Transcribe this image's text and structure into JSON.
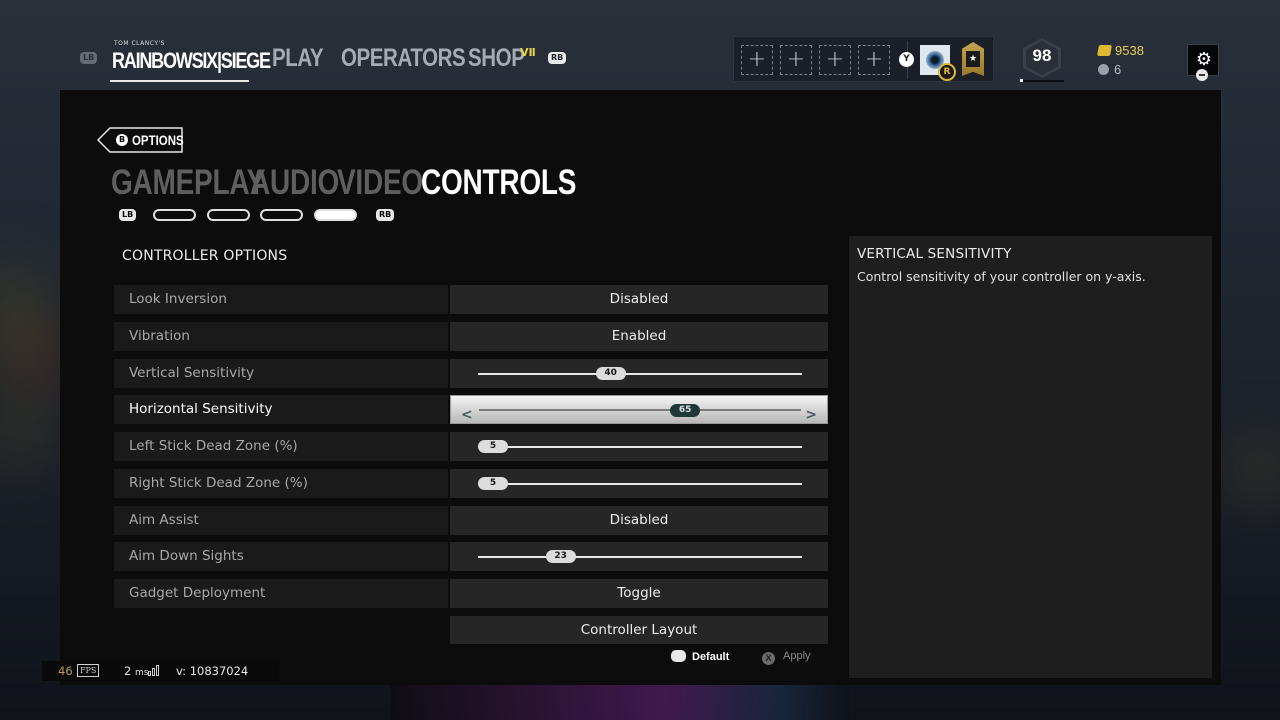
{
  "topnav": {
    "lb": "LB",
    "rb": "RB",
    "logo_small": "TOM CLANCY'S",
    "logo_main": "RAINBOWSIX|SIEGE",
    "items": [
      {
        "label": "PLAY"
      },
      {
        "label": "OPERATORS"
      },
      {
        "label": "SHOP"
      }
    ],
    "shop_badge": "VⅡ",
    "squad": {
      "slots": [
        "+",
        "+",
        "+",
        "+"
      ],
      "invite_button": "Y",
      "rank_badge": "R"
    },
    "level": "98",
    "level_progress": 0.05,
    "credits": "9538",
    "renown": "6",
    "settings_icon": "gear-icon"
  },
  "options": {
    "back_button_key": "B",
    "back_label": "OPTIONS",
    "tabs": [
      {
        "label": "GAMEPLAY",
        "active": false
      },
      {
        "label": "AUDIO",
        "active": false
      },
      {
        "label": "VIDEO",
        "active": false
      },
      {
        "label": "CONTROLS",
        "active": true
      }
    ],
    "tab_lb": "LB",
    "tab_rb": "RB",
    "pagination": {
      "total": 4,
      "active_index": 3
    },
    "section_title": "CONTROLLER OPTIONS",
    "rows": [
      {
        "label": "Look Inversion",
        "type": "toggle",
        "value": "Disabled"
      },
      {
        "label": "Vibration",
        "type": "toggle",
        "value": "Enabled"
      },
      {
        "label": "Vertical Sensitivity",
        "type": "slider",
        "value": "40",
        "fraction": 0.4
      },
      {
        "label": "Horizontal Sensitivity",
        "type": "slider",
        "value": "65",
        "fraction": 0.65,
        "selected": true
      },
      {
        "label": "Left Stick Dead Zone (%)",
        "type": "slider",
        "value": "5",
        "fraction": 0.0
      },
      {
        "label": "Right Stick Dead Zone (%)",
        "type": "slider",
        "value": "5",
        "fraction": 0.0
      },
      {
        "label": "Aim Assist",
        "type": "toggle",
        "value": "Disabled"
      },
      {
        "label": "Aim Down Sights",
        "type": "slider",
        "value": "23",
        "fraction": 0.23
      },
      {
        "label": "Gadget Deployment",
        "type": "toggle",
        "value": "Toggle"
      }
    ],
    "controller_layout_button": "Controller Layout",
    "default_button": "Default",
    "apply_button": "Apply",
    "apply_key": "X"
  },
  "description": {
    "title": "VERTICAL SENSITIVITY",
    "text": "Control sensitivity of your controller on y-axis."
  },
  "perf": {
    "fps": "46",
    "fps_tag": "FPS",
    "ping": "2",
    "ping_unit": "ms",
    "version": "v: 10837024"
  }
}
